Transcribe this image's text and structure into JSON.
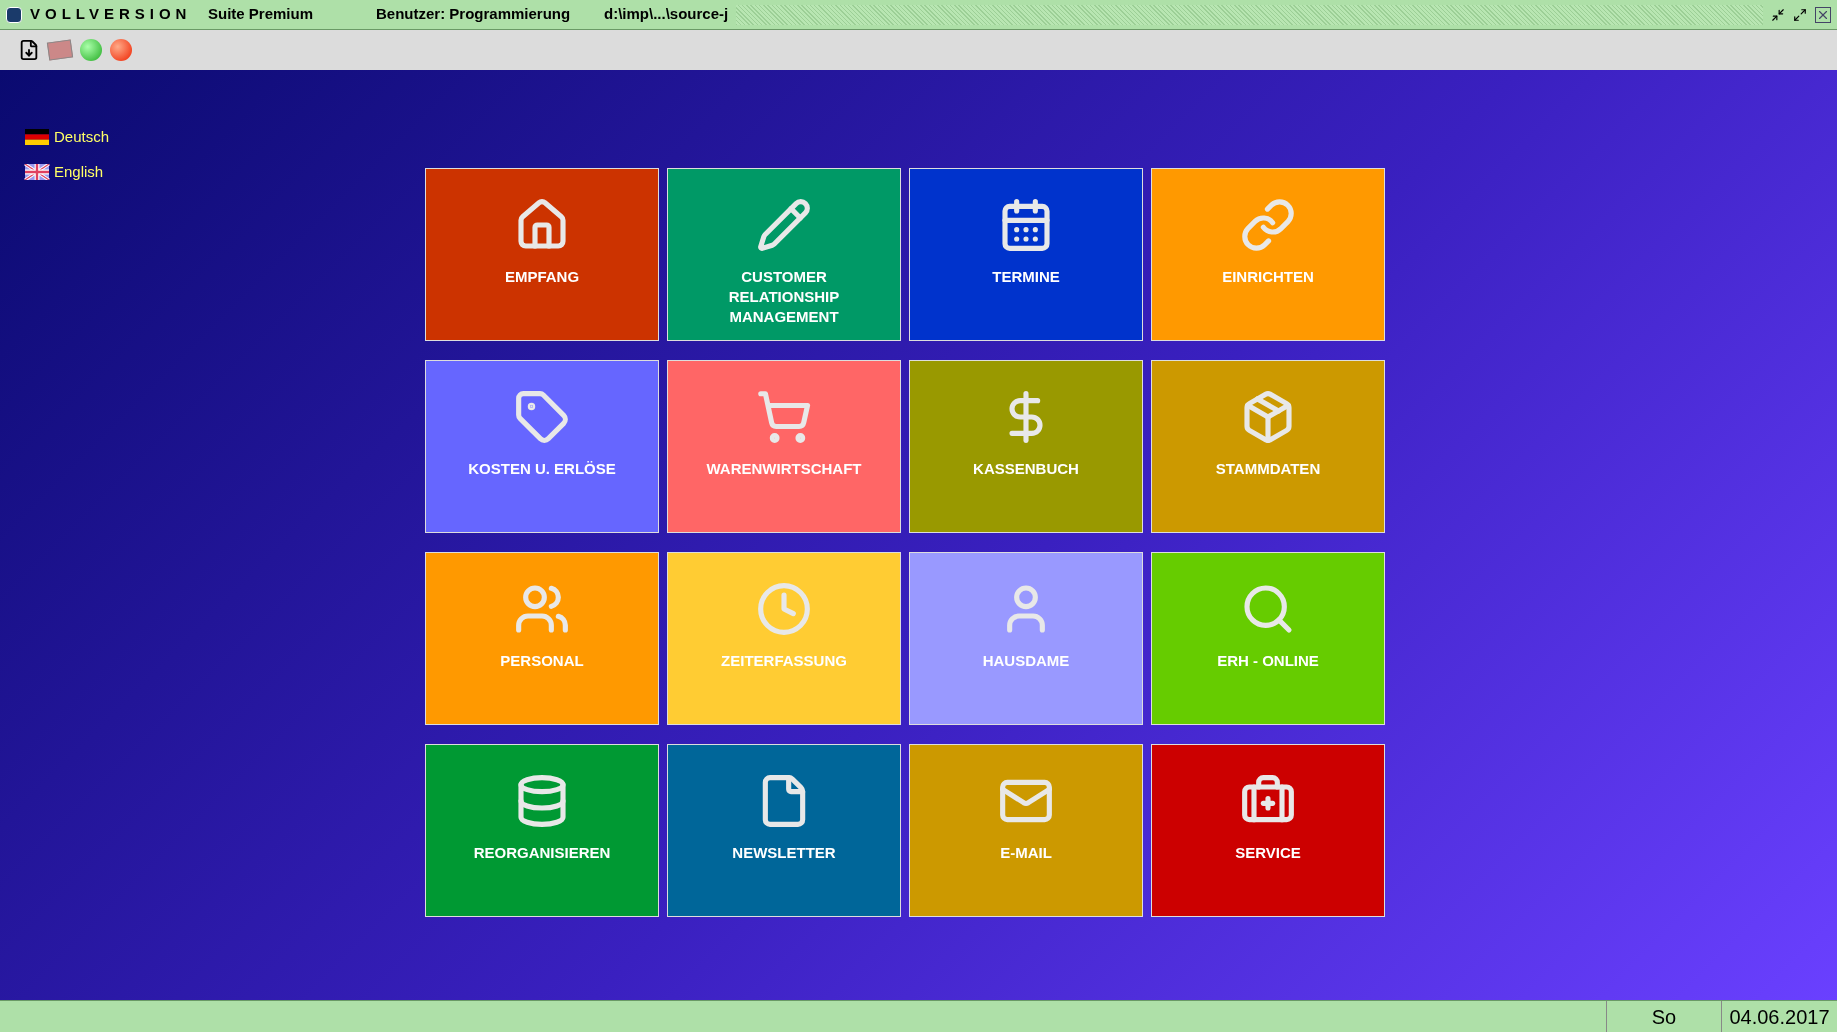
{
  "title_bar": {
    "product": "VOLLVERSION",
    "edition": "Suite Premium",
    "user": "Benutzer: Programmierung",
    "path": "d:\\imp\\...\\source-j"
  },
  "languages": [
    {
      "label": "Deutsch"
    },
    {
      "label": "English"
    }
  ],
  "tiles": [
    {
      "label": "EMPFANG",
      "color": "#cc3300"
    },
    {
      "label": "CUSTOMER RELATIONSHIP MANAGEMENT",
      "color": "#009966"
    },
    {
      "label": "TERMINE",
      "color": "#0033cc"
    },
    {
      "label": "EINRICHTEN",
      "color": "#ff9900"
    },
    {
      "label": "KOSTEN U. ERLÖSE",
      "color": "#6666ff"
    },
    {
      "label": "WARENWIRTSCHAFT",
      "color": "#ff6666"
    },
    {
      "label": "KASSENBUCH",
      "color": "#999900"
    },
    {
      "label": "STAMMDATEN",
      "color": "#cc9900"
    },
    {
      "label": "PERSONAL",
      "color": "#ff9900"
    },
    {
      "label": "ZEITERFASSUNG",
      "color": "#ffcc33"
    },
    {
      "label": "HAUSDAME",
      "color": "#9999ff"
    },
    {
      "label": "ERH - ONLINE",
      "color": "#66cc00"
    },
    {
      "label": "REORGANISIEREN",
      "color": "#009933"
    },
    {
      "label": "NEWSLETTER",
      "color": "#006699"
    },
    {
      "label": "E-MAIL",
      "color": "#cc9900"
    },
    {
      "label": "SERVICE",
      "color": "#cc0000"
    }
  ],
  "status_bar": {
    "day": "So",
    "date": "04.06.2017"
  }
}
